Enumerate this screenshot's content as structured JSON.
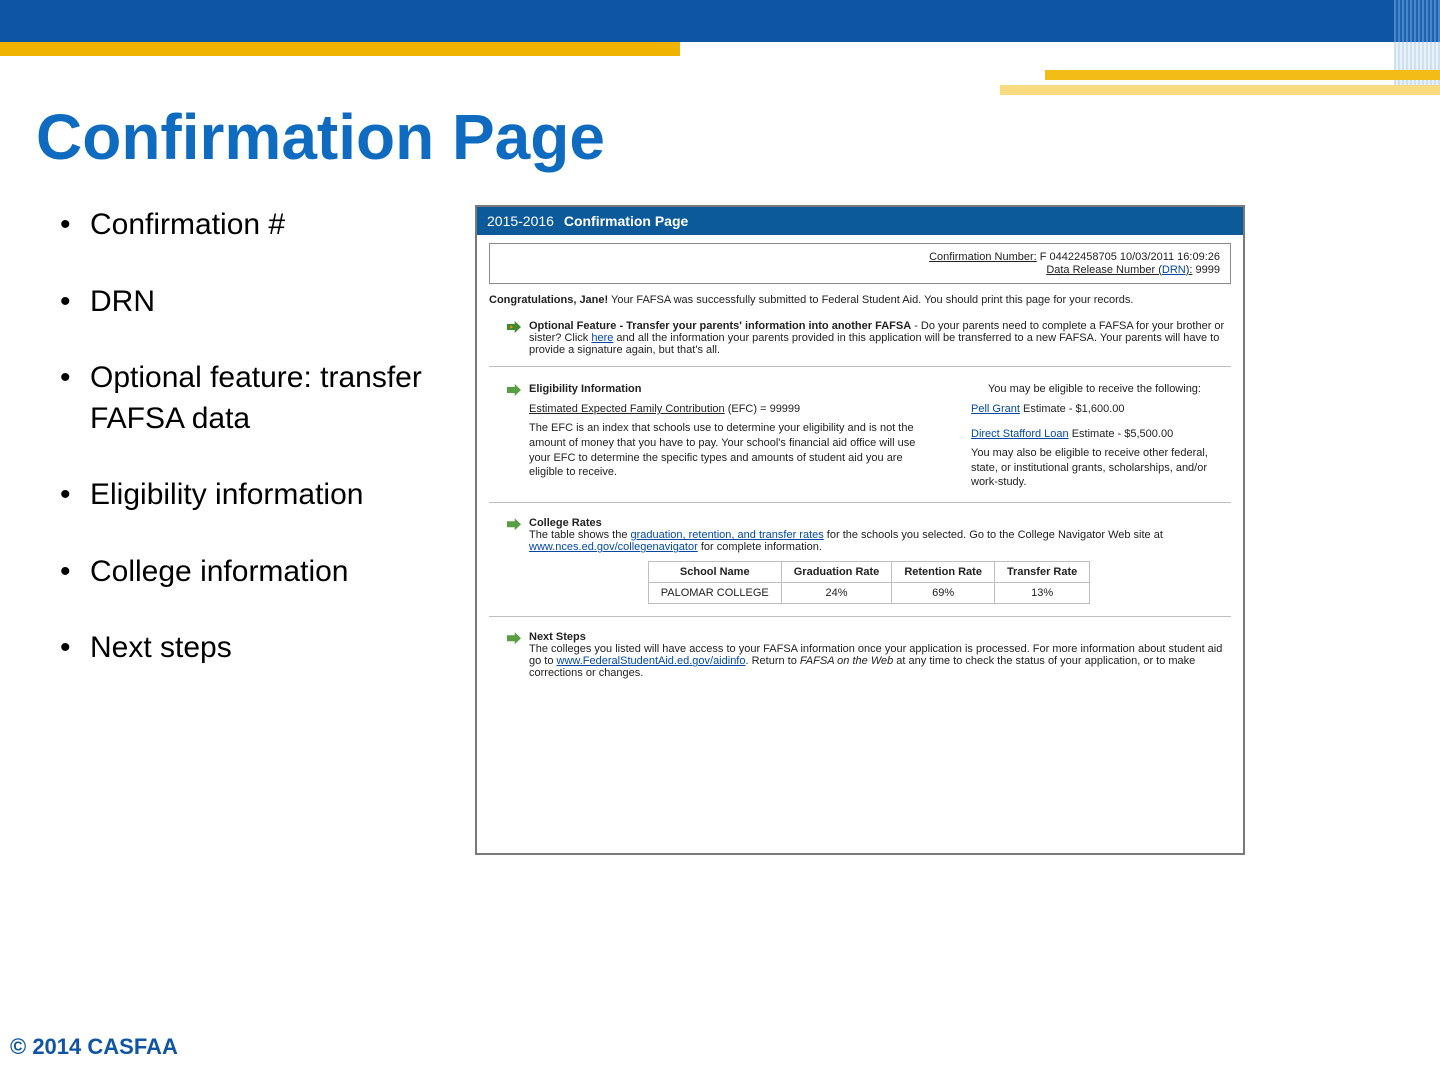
{
  "slide": {
    "title": "Confirmation Page",
    "bullets": [
      "Confirmation #",
      "DRN",
      "Optional feature: transfer FAFSA data",
      "Eligibility information",
      "College information",
      "Next steps"
    ],
    "footer": "© 2014 CASFAA"
  },
  "panel": {
    "year": "2015-2016",
    "title": "Confirmation Page",
    "confirmation": {
      "label": "Confirmation Number:",
      "value": "F 04422458705 10/03/2011 16:09:26",
      "drn_label_prefix": "Data Release Number (",
      "drn_link": "DRN",
      "drn_label_suffix": "):",
      "drn_value": "9999"
    },
    "congrats": {
      "bold": "Congratulations, Jane!",
      "rest": " Your FAFSA was successfully submitted to Federal Student Aid. You should print this page for your records."
    },
    "optional_feature": {
      "bold": "Optional Feature - Transfer your parents' information into another FAFSA",
      "text_before_link": " - Do your parents need to complete a FAFSA for your brother or sister? Click ",
      "link": "here",
      "text_after_link": " and all the information your parents provided in this application will be transferred to a new FAFSA. Your parents will have to provide a signature again, but that's all."
    },
    "eligibility": {
      "title": "Eligibility Information",
      "right_intro": "You may be eligible to receive the following:",
      "efc_label": "Estimated Expected Family Contribution",
      "efc_value_suffix": " (EFC) = 99999",
      "efc_desc": "The EFC is an index that schools use to determine your eligibility and is not the amount of money that you have to pay. Your school's financial aid office will use your EFC to determine the specific types and amounts of student aid you are eligible to receive.",
      "pell_link": "Pell Grant",
      "pell_rest": " Estimate - $1,600.00",
      "stafford_link": "Direct Stafford Loan",
      "stafford_rest": " Estimate - $5,500.00",
      "other_text": "You may also be eligible to receive other federal, state, or institutional grants, scholarships, and/or work-study."
    },
    "college_rates": {
      "title": "College Rates",
      "text_before_link1": "The table shows the ",
      "link1": "graduation, retention, and transfer rates",
      "text_mid": " for the schools you selected. Go to the College Navigator Web site at ",
      "link2": "www.nces.ed.gov/collegenavigator",
      "text_after": " for complete information.",
      "headers": [
        "School Name",
        "Graduation Rate",
        "Retention Rate",
        "Transfer Rate"
      ],
      "row": {
        "school": "PALOMAR COLLEGE",
        "grad": "24%",
        "ret": "69%",
        "trans": "13%"
      }
    },
    "next_steps": {
      "title": "Next Steps",
      "text_before_link": "The colleges you listed will have access to your FAFSA information once your application is processed. For more information about student aid go to ",
      "link": "www.FederalStudentAid.ed.gov/aidinfo",
      "text_mid": ". Return to ",
      "italic": "FAFSA on the Web",
      "text_after": " at any time to check the status of your application, or to make corrections or changes."
    }
  }
}
